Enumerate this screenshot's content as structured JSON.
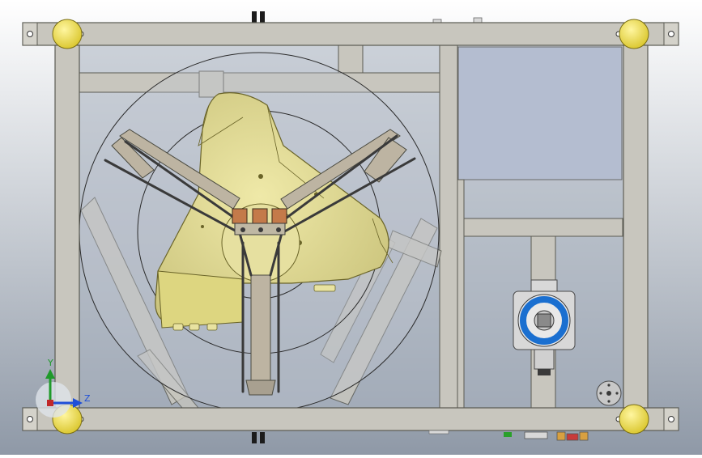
{
  "viewport": {
    "background_top": "#ffffff",
    "background_bottom": "#8f99a7"
  },
  "colors": {
    "frame_fill": "#c8c6be",
    "frame_stroke": "#5a5a52",
    "corner_ball": "#e8d84a",
    "hopper_fill": "#e2dc8a",
    "hopper_stroke": "#6a6428",
    "arm_fill": "#bdb4a2",
    "tension_rod": "#3a3a3a",
    "guide_circle": "#2a2a2a",
    "panel_fill": "#b4bdd0",
    "motor_ring": "#1a6fd0",
    "bracket_fill": "#c47a4a"
  },
  "triad": {
    "y_label": "Y",
    "z_label": "Z",
    "y_color": "#1f9a2a",
    "z_color": "#1f4fd8"
  }
}
